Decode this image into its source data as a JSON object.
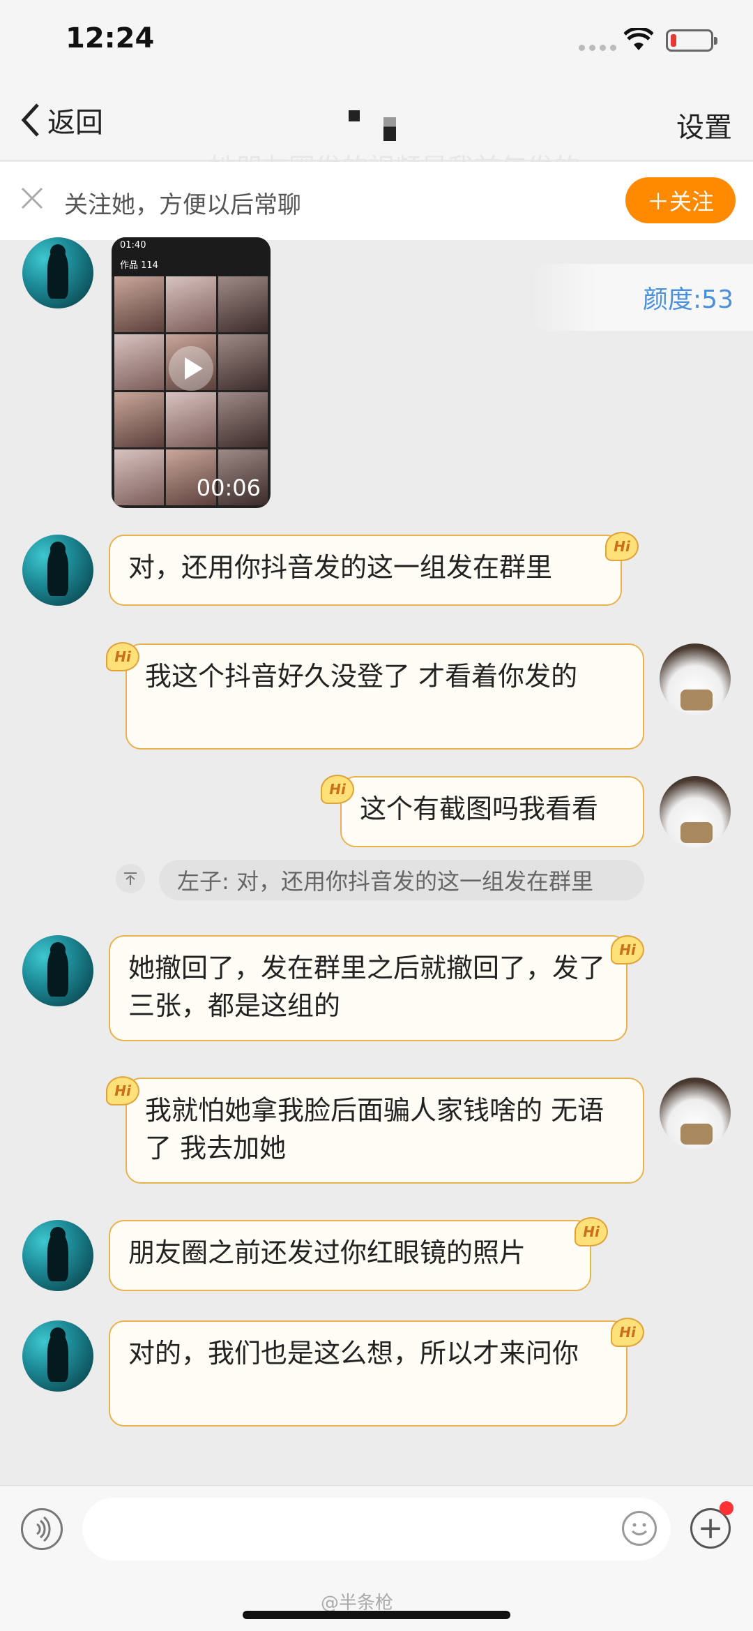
{
  "status_bar": {
    "time": "12:24"
  },
  "nav": {
    "back_label": "返回",
    "settings_label": "设置",
    "ghost_text": "她朋友圈发的视频是我前年发的"
  },
  "follow_bar": {
    "tip": "关注她，方便以后常聊",
    "button": "＋关注"
  },
  "heat": {
    "label": "颜度:53"
  },
  "video": {
    "time": "01:40",
    "header": "作品 114",
    "duration": "00:06"
  },
  "messages": [
    {
      "side": "left",
      "text": "对，还用你抖音发的这一组发在群里"
    },
    {
      "side": "right",
      "text": "我这个抖音好久没登了 才看着你发的"
    },
    {
      "side": "right",
      "text": "这个有截图吗我看看"
    },
    {
      "side": "left",
      "text": "她撤回了，发在群里之后就撤回了，发了三张，都是这组的"
    },
    {
      "side": "right",
      "text": "我就怕她拿我脸后面骗人家钱啥的 无语了 我去加她"
    },
    {
      "side": "left",
      "text": "朋友圈之前还发过你红眼镜的照片"
    },
    {
      "side": "left",
      "text": "对的，我们也是这么想，所以才来问你"
    }
  ],
  "quote": {
    "text": "左子: 对，还用你抖音发的这一组发在群里"
  },
  "hi_badge": "Hi",
  "watermark": "@半条枪"
}
